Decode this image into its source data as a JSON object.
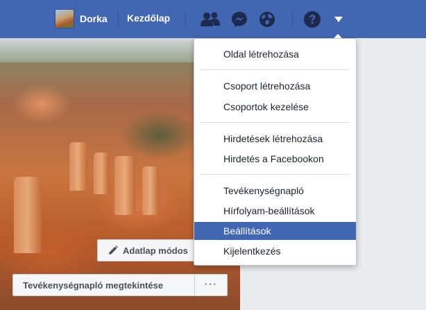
{
  "topbar": {
    "profile_name": "Dorka",
    "home_label": "Kezdőlap",
    "icons": [
      "friends-icon",
      "messenger-icon",
      "globe-icon",
      "help-icon",
      "chevron-down-icon"
    ]
  },
  "cover": {
    "edit_profile_label": "Adatlap módos",
    "activity_log_label": "Tevékenységnapló megtekintése",
    "more_label": "···"
  },
  "dropdown": {
    "groups": [
      [
        "Oldal létrehozása"
      ],
      [
        "Csoport létrehozása",
        "Csoportok kezelése"
      ],
      [
        "Hirdetések létrehozása",
        "Hirdetés a Facebookon"
      ],
      [
        "Tevékenységnapló",
        "Hírfolyam-beállítások",
        "Beállítások",
        "Kijelentkezés"
      ]
    ],
    "active_item": "Beállítások"
  },
  "colors": {
    "topbar_blue": "#4267b2",
    "highlight_blue": "#4267b2",
    "icon_dark": "#1d2a4d"
  }
}
